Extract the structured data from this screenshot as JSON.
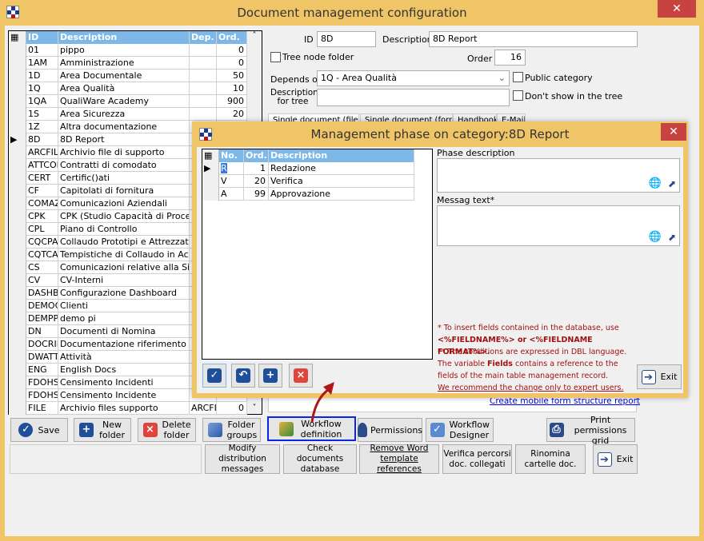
{
  "window": {
    "title": "Document management configuration",
    "close": "✕"
  },
  "grid": {
    "headers": [
      "ID",
      "Description",
      "Dep.",
      "Ord."
    ],
    "rows": [
      [
        "01",
        "pippo",
        "",
        "0"
      ],
      [
        "1AM",
        "Amministrazione",
        "",
        "0"
      ],
      [
        "1D",
        "Area Documentale",
        "",
        "50"
      ],
      [
        "1Q",
        "Area Qualità",
        "",
        "10"
      ],
      [
        "1QA",
        "QualiWare Academy",
        "",
        "900"
      ],
      [
        "1S",
        "Area Sicurezza",
        "",
        "20"
      ],
      [
        "1Z",
        "Altra documentazione",
        "",
        ""
      ],
      [
        "8D",
        "8D Report",
        "",
        ""
      ],
      [
        "ARCFIL",
        "Archivio file di supporto",
        "",
        ""
      ],
      [
        "ATTCOM",
        "Contratti di comodato",
        "",
        ""
      ],
      [
        "CERT",
        "Certific()ati",
        "",
        ""
      ],
      [
        "CF",
        "Capitolati di fornitura",
        "",
        ""
      ],
      [
        "COMAZ",
        "Comunicazioni Aziendali",
        "",
        ""
      ],
      [
        "CPK",
        "CPK (Studio Capacità di Process",
        "",
        ""
      ],
      [
        "CPL",
        "Piano di Controllo",
        "",
        ""
      ],
      [
        "CQCPA",
        "Collaudo Prototipi e Attrezzatu",
        "",
        ""
      ],
      [
        "CQTCA",
        "Tempistiche di Collaudo in Acce",
        "",
        ""
      ],
      [
        "CS",
        "Comunicazioni relative alla Sicu",
        "",
        ""
      ],
      [
        "CV",
        "CV-Interni",
        "",
        ""
      ],
      [
        "DASHB",
        "Configurazione Dashboard",
        "",
        ""
      ],
      [
        "DEMOC",
        "Clienti",
        "",
        ""
      ],
      [
        "DEMPPI",
        "demo pi",
        "",
        ""
      ],
      [
        "DN",
        "Documenti di Nomina",
        "",
        ""
      ],
      [
        "DOCRIF",
        "Documentazione riferimento",
        "",
        ""
      ],
      [
        "DWATT",
        "Attività",
        "",
        ""
      ],
      [
        "ENG",
        "English Docs",
        "",
        ""
      ],
      [
        "FDOHS",
        "Censimento Incidenti",
        "",
        ""
      ],
      [
        "FDOHS",
        "Censimento Incidente",
        "",
        ""
      ],
      [
        "FILE",
        "Archivio files supporto",
        "ARCFIL",
        "0"
      ]
    ],
    "selected_index": 7
  },
  "form": {
    "id_label": "ID",
    "id_value": "8D",
    "description_label": "Description",
    "description_value": "8D Report",
    "tree_node_folder": "Tree node folder",
    "order_label": "Order",
    "order_value": "16",
    "depends_on_label": "Depends on",
    "depends_on_value": "1Q - Area Qualità",
    "public_category": "Public category",
    "description_tree_label": "Description for tree",
    "description_tree_value": "",
    "dont_show": "Don't show in the tree",
    "tabs": [
      "Single document (file)",
      "Single document (form)",
      "Handbook",
      "E-Mail"
    ],
    "mobile_link": "Create mobile form structure report"
  },
  "dialog": {
    "title": "Management phase on category:8D Report",
    "headers": [
      "No.",
      "Ord.",
      "Description"
    ],
    "rows": [
      [
        "R",
        "1",
        "Redazione"
      ],
      [
        "V",
        "20",
        "Verifica"
      ],
      [
        "A",
        "99",
        "Approvazione"
      ]
    ],
    "phase_description_label": "Phase description",
    "message_text_label": "Messag text*",
    "notes": {
      "n1": "* To insert fields contained in the database, use",
      "n2": "<%FIELDNAME%> or <%FIELDNAME FORMAT%>.",
      "n3": "** The conditions are expressed in DBL language. The variable",
      "n3b": "Fields",
      "n3c": "contains a reference to the fields of the main table management record.",
      "n4": "We recommend the change only to expert users."
    },
    "exit": "Exit"
  },
  "buttons": {
    "save": "Save",
    "new_folder": "New folder",
    "delete_folder": "Delete folder",
    "folder_groups": "Folder groups",
    "workflow_definition": "Workflow definition",
    "permissions": "Permissions",
    "workflow_designer": "Workflow Designer",
    "print_permissions": "Print permissions grid",
    "modify_distribution": "Modify distribution messages",
    "check_documents": "Check documents database",
    "remove_word": "Remove Word template references",
    "verifica": "Verifica percorsi doc. collegati",
    "rinomina": "Rinomina cartelle doc.",
    "exit": "Exit"
  },
  "colors": {
    "window_border": "#f0c567",
    "grid_header": "#7db8e8",
    "close": "#c7433f",
    "highlight_border": "#0a24e8",
    "note_text": "#a01010"
  }
}
